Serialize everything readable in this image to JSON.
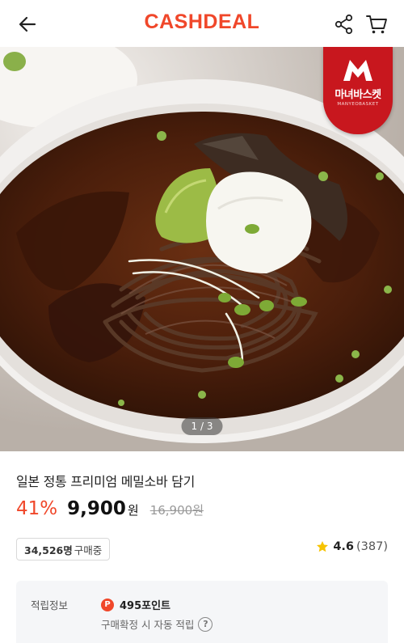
{
  "header": {
    "logo": "CASHDEAL",
    "back_icon": "arrow-left-icon",
    "share_icon": "share-icon",
    "cart_icon": "cart-icon"
  },
  "gallery": {
    "pager": "1 / 3",
    "brand_badge": {
      "name": "마녀바스켓",
      "sub": "MANYEOBASKET"
    }
  },
  "product": {
    "title": "일본 정통 프리미엄 메밀소바 담기",
    "discount": "41%",
    "price": "9,900",
    "currency": "원",
    "original_price": "16,900원",
    "buyers": {
      "count": "34,526명",
      "suffix": "구매중"
    },
    "rating": {
      "score": "4.6",
      "count": "(387)"
    }
  },
  "points": {
    "label": "적립정보",
    "icon_letter": "P",
    "value": "495포인트",
    "note": "구매확정 시 자동 적립",
    "help": "?"
  },
  "colors": {
    "accent": "#f0472a",
    "badge": "#c8171e",
    "star": "#f6c300"
  }
}
